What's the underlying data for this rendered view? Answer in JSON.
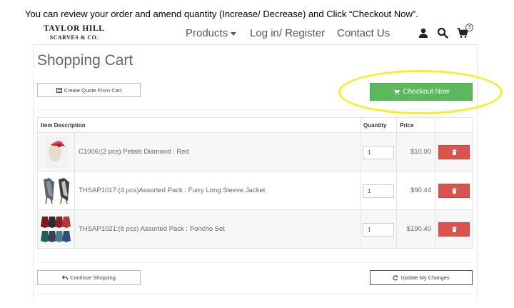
{
  "instruction": "You can review your order and amend quantity (Increase/ Decrease) and Click “Checkout Now”.",
  "header": {
    "logo_line1": "TAYLOR HILL",
    "logo_line2": "SCARVES & CO.",
    "nav": {
      "products": "Products",
      "login": "Log in/ Register",
      "contact": "Contact Us"
    },
    "icons": [
      "user-icon",
      "search-icon",
      "shopping-cart-icon"
    ],
    "cart_count": "3"
  },
  "page": {
    "title": "Shopping Cart",
    "create_quote_label": "Create Quote From Cart",
    "checkout_label": "Checkout Now",
    "continue_label": "Continue Shopping",
    "update_label": "Update My Changes"
  },
  "table": {
    "headers": {
      "item": "Item Description",
      "quantity": "Quantity",
      "price": "Price"
    },
    "rows": [
      {
        "name": "C1006:(2 pcs) Petals Diamond : Red",
        "quantity": "1",
        "price": "$10.00"
      },
      {
        "name": "THSAP1017:(4 pcs)Assorted Pack : Furry Long Sleeve Jacket",
        "quantity": "1",
        "price": "$90.44"
      },
      {
        "name": "THSAP1021:(8 pcs) Assorted Pack : Poncho Set",
        "quantity": "1",
        "price": "$190.40"
      }
    ]
  },
  "colors": {
    "checkout_green": "#5cb85c",
    "delete_red": "#d9534f",
    "highlight_yellow": "#f3ef2a"
  }
}
